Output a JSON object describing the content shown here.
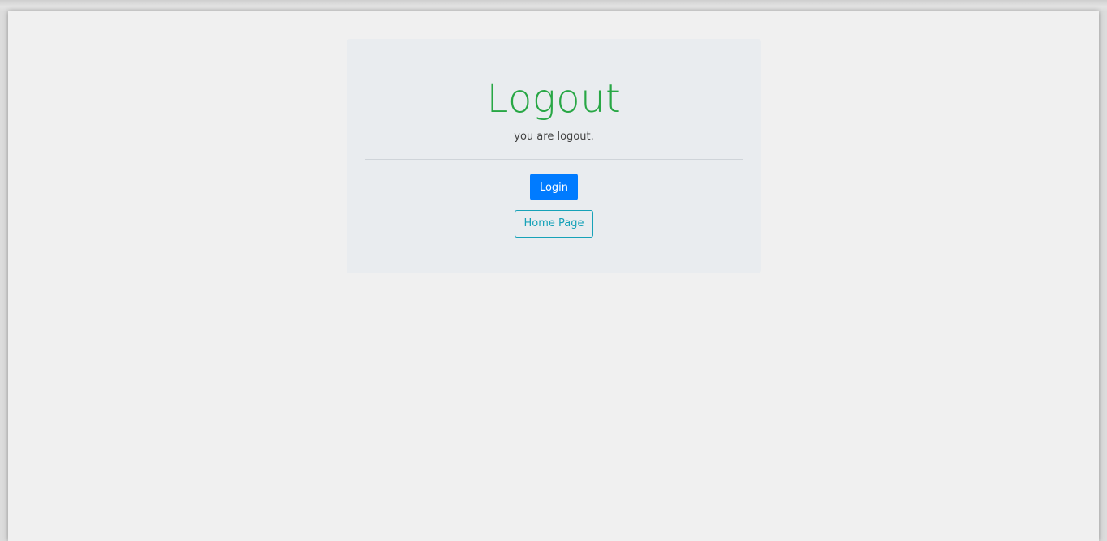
{
  "logout_panel": {
    "title": "Logout",
    "message": "you are logout.",
    "login_button": "Login",
    "home_button": "Home Page"
  },
  "colors": {
    "title": "#28a745",
    "primary": "#007bff",
    "info": "#17a2b8",
    "panel_background": "#e9ecef",
    "page_background": "#f0f0f0"
  }
}
